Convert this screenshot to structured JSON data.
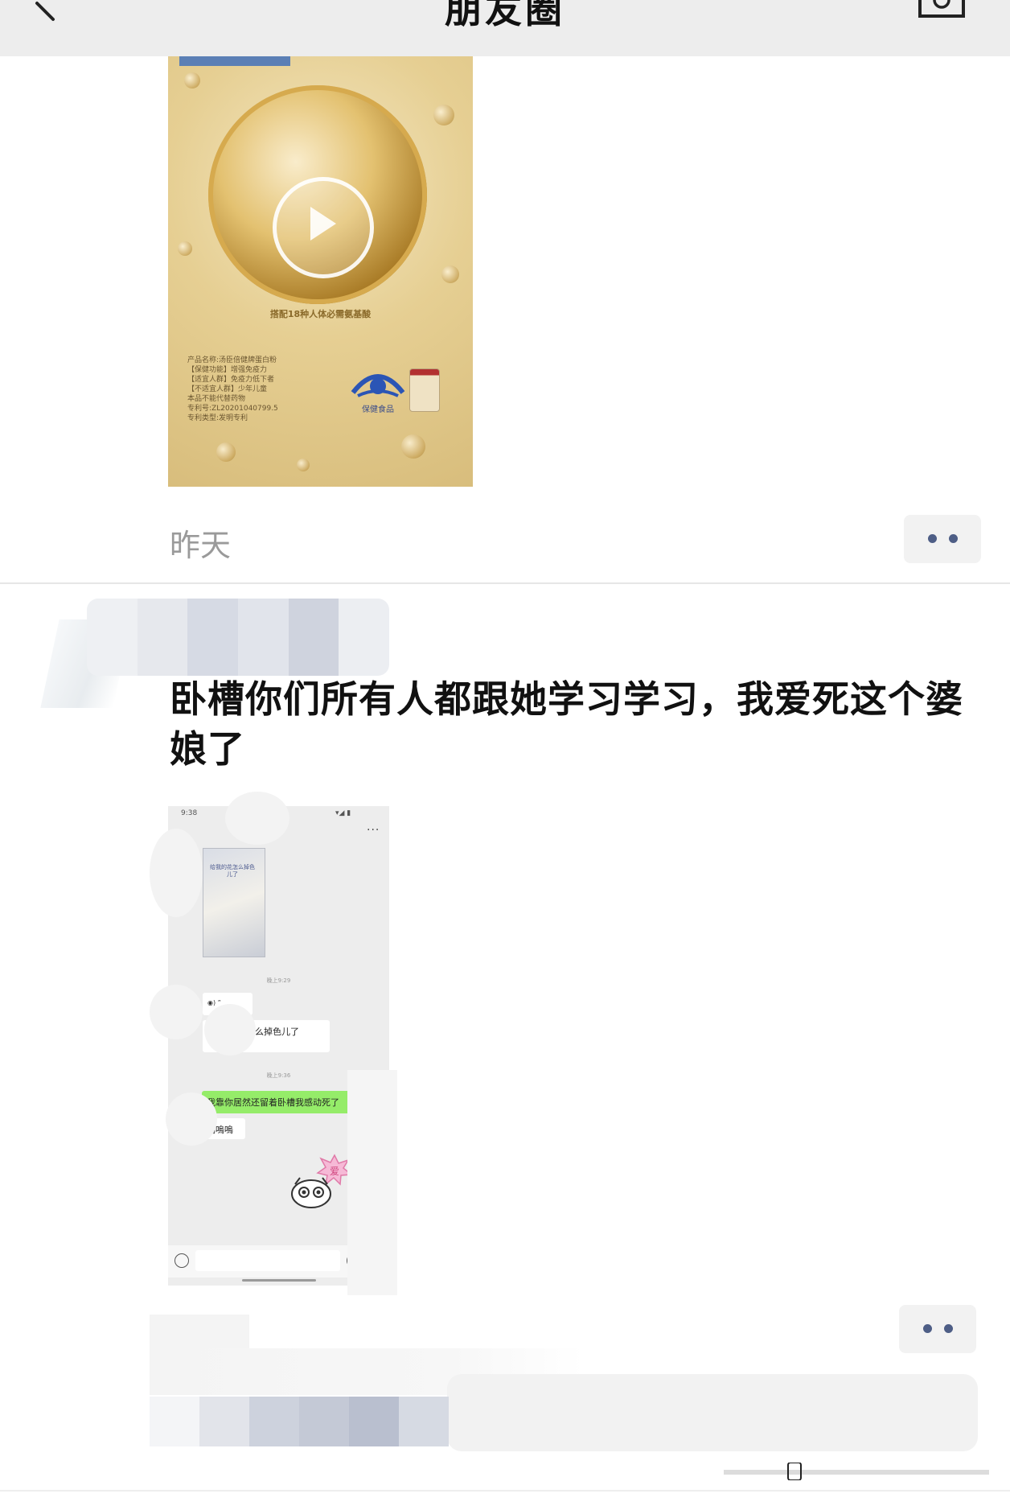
{
  "header": {
    "title": "朋友圈",
    "back_icon": "chevron-left-icon",
    "camera_icon": "camera-icon",
    "background": "#ededed"
  },
  "post1": {
    "video": {
      "caption": "搭配18种人体必需氨基酸",
      "fine_print": [
        "产品名称:汤臣倍健牌蛋白粉",
        "【保健功能】增强免疫力",
        "【适宜人群】免疫力低下者",
        "【不适宜人群】少年儿童",
        "本品不能代替药物",
        "专利号:ZL20201040799.5",
        "专利类型:发明专利"
      ],
      "brand_label": "保健食品",
      "play_icon": "play-icon"
    },
    "time": "昨天"
  },
  "post2": {
    "text": "卧槽你们所有人都跟她学习学习，我爱死这个婆娘了",
    "screenshot": {
      "status_time": "9:38",
      "status_right": "▾◢ ▮",
      "more": "···",
      "photo_text": "给我的花怎么掉色儿了",
      "timestamp1": "晚上9:29",
      "voice": "◉) ”",
      "received": "给我的花怎么掉色儿了",
      "timestamp2": "晚上9:36",
      "sent": "我靠你居然还留着卧槽我感动死了",
      "sent2": "嗚嗚嗚",
      "sticker_text": "爱"
    }
  },
  "colors": {
    "accent_dots": "#4e5e86",
    "wechat_green": "#95ec69",
    "time_gray": "#9a9a9a"
  }
}
